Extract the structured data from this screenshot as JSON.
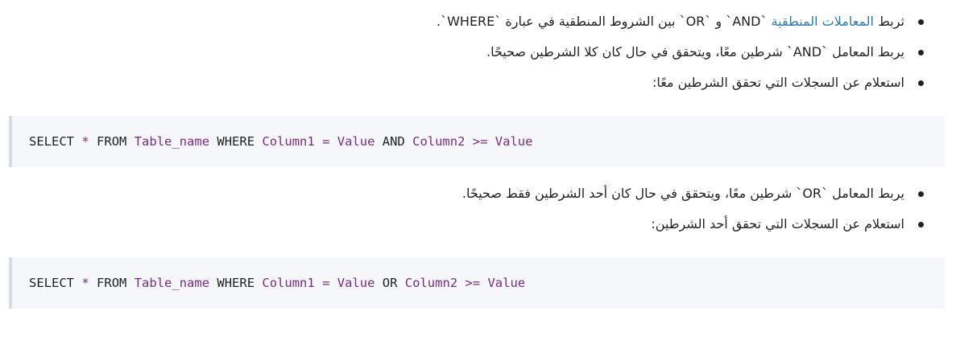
{
  "intro_list": {
    "items": [
      {
        "text_before": "ثربط ",
        "link_text": "المعاملات المنطقية",
        "text_after": " `AND` و `OR` بين الشروط المنطقية في عبارة `WHERE`."
      },
      {
        "text": "يربط المعامل `AND` شرطين معًا، ويتحقق في حال كان كلا الشرطين صحيحًا."
      },
      {
        "text": "استعلام عن السجلات التي تحقق الشرطين معًا:"
      }
    ]
  },
  "code_and": {
    "tokens": [
      "SELECT",
      "*",
      "FROM",
      "Table_name",
      "WHERE",
      "Column1",
      "=",
      "Value",
      "AND",
      "Column2",
      ">=",
      "Value"
    ]
  },
  "or_list": {
    "items": [
      {
        "text": "يربط المعامل `OR` شرطين معًا، ويتحقق في حال كان أحد الشرطين فقط صحيحًا."
      },
      {
        "text": "استعلام عن السجلات التي تحقق أحد الشرطين:"
      }
    ]
  },
  "code_or": {
    "tokens": [
      "SELECT",
      "*",
      "FROM",
      "Table_name",
      "WHERE",
      "Column1",
      "=",
      "Value",
      "OR",
      "Column2",
      ">=",
      "Value"
    ]
  },
  "colors": {
    "text": "#222222",
    "link": "#2a7ab0",
    "code_identifier": "#7d2a87",
    "code_background": "#f5f7fa",
    "code_border": "#d8dde3"
  }
}
